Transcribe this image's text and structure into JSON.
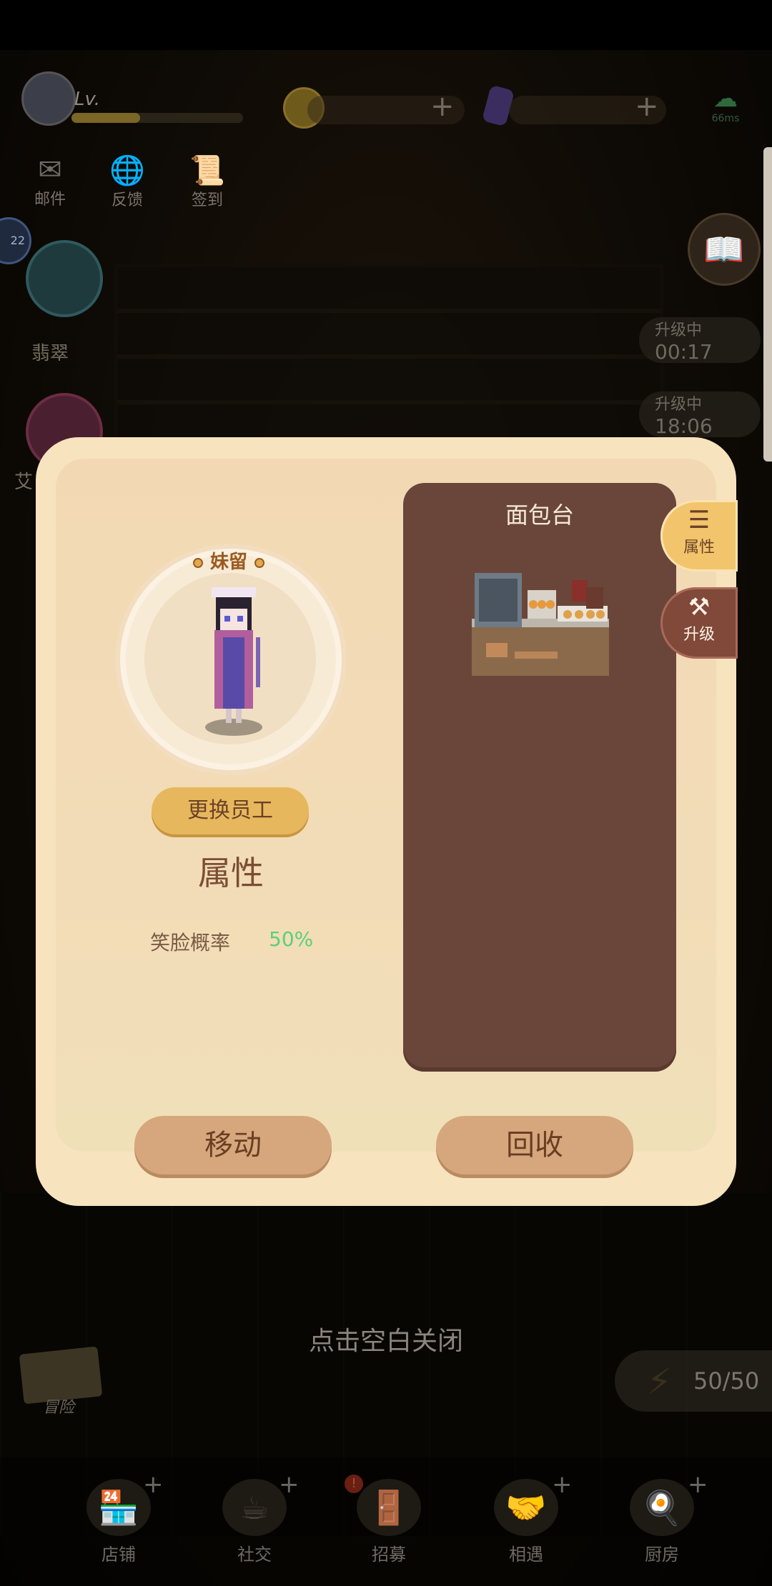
{
  "hud": {
    "level_label": "Lv.",
    "ping": "66ms"
  },
  "top_icons": [
    {
      "label": "邮件",
      "icon": "mail-icon"
    },
    {
      "label": "反馈",
      "icon": "feedback-icon"
    },
    {
      "label": "签到",
      "icon": "signin-icon"
    }
  ],
  "left": {
    "edge_badge": "22",
    "emerald_label": "翡翠",
    "partial_label": "艾"
  },
  "right": {
    "upgrade_1": {
      "status": "升级中",
      "time": "00:17"
    },
    "upgrade_2": {
      "status": "升级中",
      "time": "18:06"
    }
  },
  "modal": {
    "employee_name": "妹留",
    "change_employee": "更换员工",
    "section_title": "属性",
    "stat_label": "笑脸概率",
    "stat_value": "50%",
    "station_title": "面包台",
    "tabs": {
      "attributes": "属性",
      "upgrade": "升级"
    },
    "move": "移动",
    "recycle": "回收"
  },
  "close_hint": "点击空白关闭",
  "adventure_label": "冒险",
  "energy": "50/50",
  "nav": [
    {
      "label": "店铺",
      "icon": "shop-icon"
    },
    {
      "label": "社交",
      "icon": "coffee-icon"
    },
    {
      "label": "招募",
      "icon": "recruit-door-icon"
    },
    {
      "label": "相遇",
      "icon": "handshake-icon"
    },
    {
      "label": "厨房",
      "icon": "frying-pan-icon"
    }
  ],
  "colors": {
    "modal_bg": "#f7e3bd",
    "panel": "#6a463a",
    "accent": "#e7b75d",
    "stat_green": "#5bd07a"
  }
}
